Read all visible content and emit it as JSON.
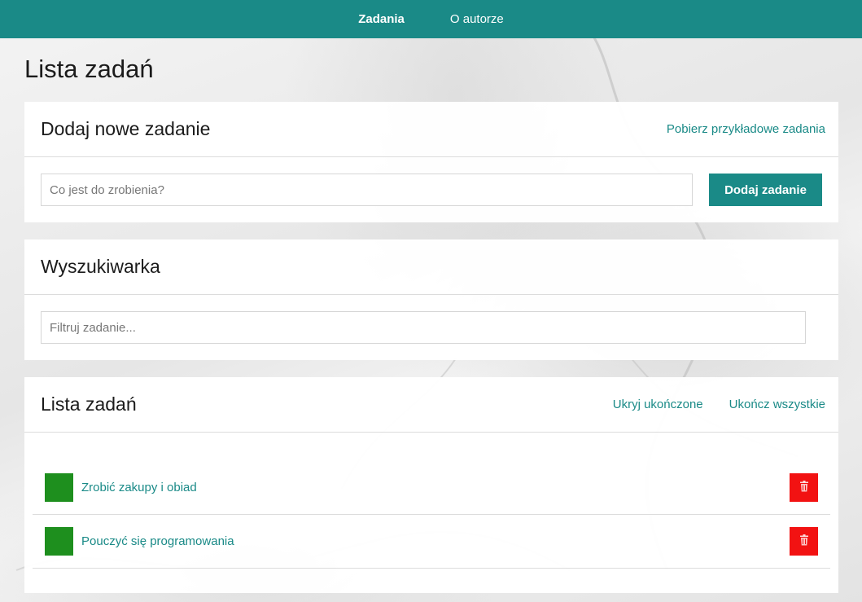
{
  "nav": {
    "items": [
      {
        "label": "Zadania"
      },
      {
        "label": "O autorze"
      }
    ]
  },
  "page": {
    "title": "Lista zadań"
  },
  "add_card": {
    "title": "Dodaj nowe zadanie",
    "sample_link": "Pobierz przykładowe zadania",
    "input_placeholder": "Co jest do zrobienia?",
    "input_value": "",
    "button_label": "Dodaj zadanie"
  },
  "search_card": {
    "title": "Wyszukiwarka",
    "input_placeholder": "Filtruj zadanie...",
    "input_value": ""
  },
  "list_card": {
    "title": "Lista zadań",
    "hide_completed": "Ukryj ukończone",
    "complete_all": "Ukończ wszystkie",
    "tasks": [
      {
        "text": "Zrobić zakupy i obiad"
      },
      {
        "text": "Pouczyć się programowania"
      }
    ]
  },
  "colors": {
    "accent": "#1a8a87",
    "check": "#1e8f1e",
    "delete": "#f21212"
  },
  "icons": {
    "delete": "trash-icon"
  }
}
